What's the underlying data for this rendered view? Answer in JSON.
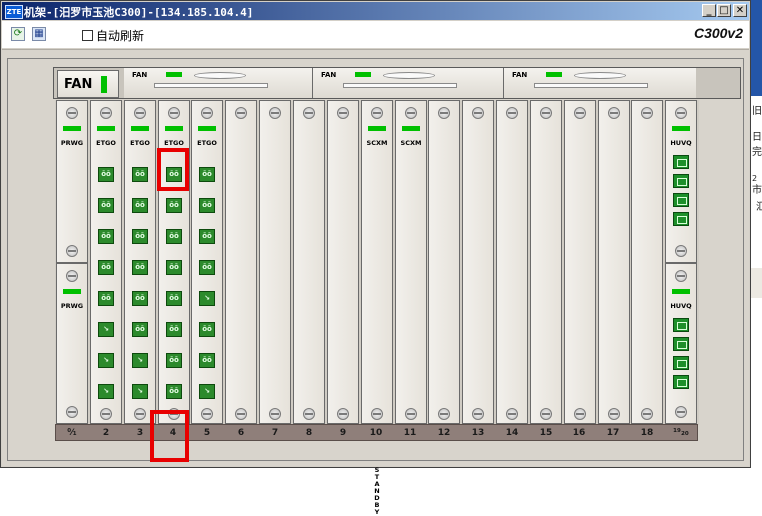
{
  "window": {
    "logo": "ZTE",
    "title": "机架-[汨罗市玉池C300]-[134.185.104.4]",
    "model": "C300v2",
    "minimize": "_",
    "maximize": "□",
    "close": "✕"
  },
  "toolbar": {
    "refresh_icon": "refresh-icon",
    "grid_icon": "grid-icon",
    "auto_refresh_label": "自动刷新",
    "auto_refresh_checked": false
  },
  "rack": {
    "main_fan_label": "FAN",
    "fan_units": [
      {
        "label": "FAN"
      },
      {
        "label": "FAN"
      },
      {
        "label": "FAN"
      },
      {
        "label": "FAN"
      }
    ],
    "cards": [
      {
        "slot": "0",
        "name": "PRWG"
      },
      {
        "slot": "1",
        "name": "PRWG"
      },
      {
        "slot": "2",
        "name": "ETGO"
      },
      {
        "slot": "3",
        "name": "ETGO"
      },
      {
        "slot": "4",
        "name": "ETGO"
      },
      {
        "slot": "5",
        "name": "ETGO"
      },
      {
        "slot": "10",
        "name": "SCXM",
        "standby": "STANDBY"
      },
      {
        "slot": "11",
        "name": "SCXM"
      },
      {
        "slot": "19",
        "name": "HUVQ"
      },
      {
        "slot": "20",
        "name": "HUVQ"
      }
    ],
    "slot_numbers": [
      "0/1",
      "2",
      "3",
      "4",
      "5",
      "6",
      "7",
      "8",
      "9",
      "10",
      "11",
      "12",
      "13",
      "14",
      "15",
      "16",
      "17",
      "18",
      "19/20"
    ],
    "port_glyphs": [
      "ōō",
      "↘"
    ],
    "status_color": "#00c000",
    "highlight_color": "#e80000",
    "highlighted_slot": "4"
  },
  "background_window_fragments": [
    "旧",
    "日完",
    "2",
    "市",
    "汇"
  ]
}
